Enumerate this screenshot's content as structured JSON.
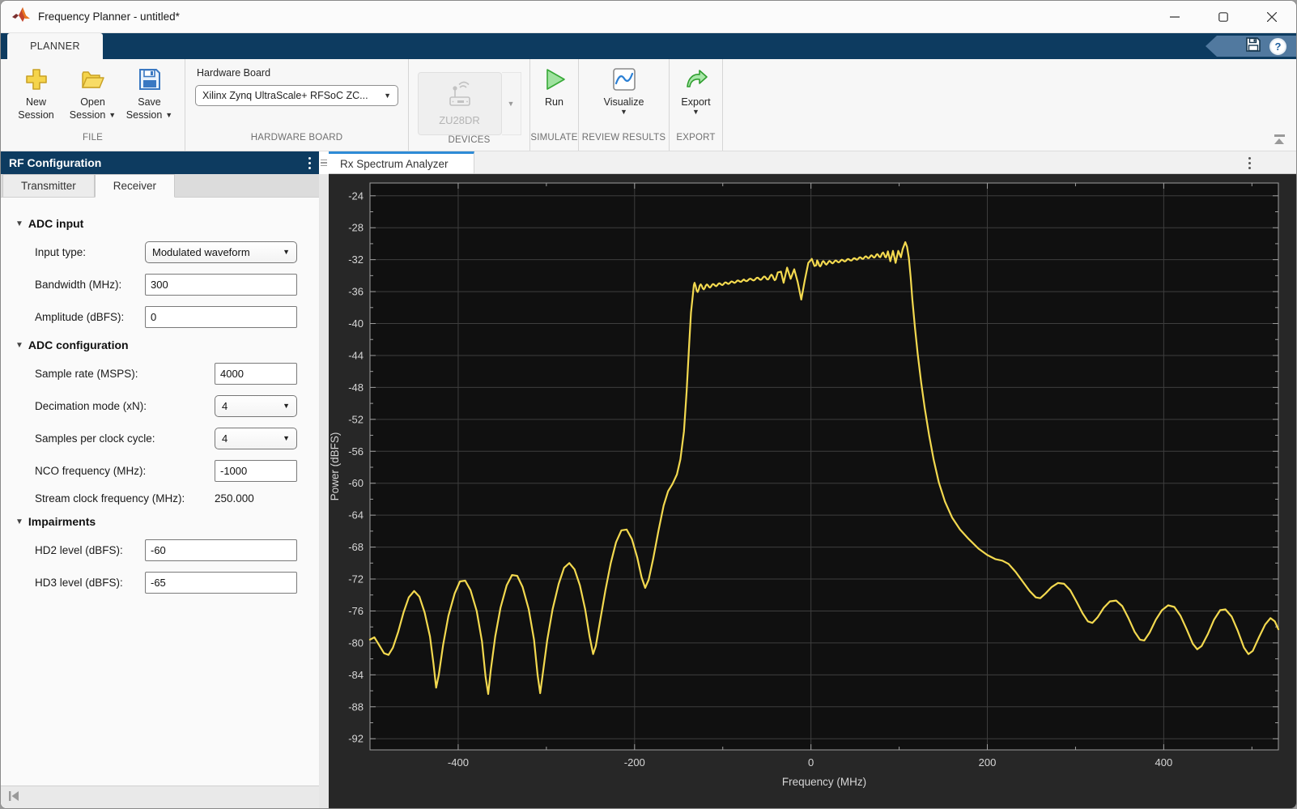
{
  "window": {
    "title": "Frequency Planner - untitled*"
  },
  "ribbon": {
    "tab_label": "PLANNER"
  },
  "toolbar": {
    "file": {
      "group_label": "FILE",
      "buttons": [
        {
          "label_top": "New",
          "label_bottom": "Session",
          "icon": "new-session-icon",
          "dropdown": false
        },
        {
          "label_top": "Open",
          "label_bottom": "Session",
          "icon": "open-folder-icon",
          "dropdown": true
        },
        {
          "label_top": "Save",
          "label_bottom": "Session",
          "icon": "save-disk-icon",
          "dropdown": true
        }
      ]
    },
    "hardware": {
      "group_label": "HARDWARE BOARD",
      "field_label": "Hardware Board",
      "dropdown_value": "Xilinx Zynq UltraScale+ RFSoC ZC..."
    },
    "devices": {
      "group_label": "DEVICES",
      "device_name": "ZU28DR"
    },
    "simulate": {
      "group_label": "SIMULATE",
      "run_label": "Run"
    },
    "review": {
      "group_label": "REVIEW RESULTS",
      "visualize_label": "Visualize"
    },
    "export": {
      "group_label": "EXPORT",
      "export_label": "Export"
    }
  },
  "left_panel": {
    "title": "RF Configuration",
    "tabs": [
      {
        "label": "Transmitter"
      },
      {
        "label": "Receiver"
      }
    ],
    "sections": [
      {
        "title": "ADC input",
        "rows": [
          {
            "label": "Input type:",
            "control": "dropdown",
            "value": "Modulated waveform",
            "narrow": false
          },
          {
            "label": "Bandwidth (MHz):",
            "control": "input",
            "value": "300",
            "narrow": false
          },
          {
            "label": "Amplitude (dBFS):",
            "control": "input",
            "value": "0",
            "narrow": false
          }
        ]
      },
      {
        "title": "ADC configuration",
        "rows": [
          {
            "label": "Sample rate (MSPS):",
            "control": "input",
            "value": "4000",
            "narrow": true
          },
          {
            "label": "Decimation mode (xN):",
            "control": "dropdown",
            "value": "4",
            "narrow": true
          },
          {
            "label": "Samples per clock cycle:",
            "control": "dropdown",
            "value": "4",
            "narrow": true
          },
          {
            "label": "NCO frequency (MHz):",
            "control": "input",
            "value": "-1000",
            "narrow": true
          },
          {
            "label": "Stream clock frequency (MHz):",
            "control": "static",
            "value": "250.000",
            "narrow": true
          }
        ]
      },
      {
        "title": "Impairments",
        "rows": [
          {
            "label": "HD2 level (dBFS):",
            "control": "input",
            "value": "-60",
            "narrow": false
          },
          {
            "label": "HD3 level (dBFS):",
            "control": "input",
            "value": "-65",
            "narrow": false
          }
        ]
      }
    ]
  },
  "plot_panel": {
    "tab_label": "Rx Spectrum Analyzer"
  },
  "colors": {
    "accent_navy": "#0d3b60",
    "tab_stripe_blue": "#2e8bd6",
    "curve_yellow": "#f3d94f"
  },
  "chart_data": {
    "type": "line",
    "title": "",
    "xlabel": "Frequency (MHz)",
    "ylabel": "Power (dBFS)",
    "xlim": [
      -500,
      530
    ],
    "ylim": [
      -93.4,
      -22.4
    ],
    "xticks": [
      -400,
      -200,
      0,
      200,
      400
    ],
    "yticks": [
      -24,
      -28,
      -32,
      -36,
      -40,
      -44,
      -48,
      -52,
      -56,
      -60,
      -64,
      -68,
      -72,
      -76,
      -80,
      -84,
      -88,
      -92
    ],
    "x_minor": [
      -500,
      -300,
      -100,
      100,
      300,
      500
    ],
    "y_minor": [
      -26,
      -30,
      -34,
      -38,
      -42,
      -46,
      -50,
      -54,
      -58,
      -62,
      -66,
      -70,
      -74,
      -78,
      -82,
      -86,
      -90
    ],
    "grid": true,
    "legend": false,
    "bg_outer": "#272727",
    "bg_axes": "#101010",
    "grid_color": "#3e3e3e",
    "frame_color": "#9e9e9e",
    "tick_label_color": "#d6d6d6",
    "line_color": "#f3d94f",
    "line_width": 2.2,
    "series": [
      {
        "name": "Rx spectrum",
        "segments": [
          {
            "type": "points",
            "pts": [
              [
                -500,
                -79.6
              ],
              [
                -495,
                -79.3
              ],
              [
                -490,
                -80.2
              ],
              [
                -484,
                -81.3
              ],
              [
                -479,
                -81.5
              ],
              [
                -474,
                -80.6
              ],
              [
                -468,
                -78.6
              ],
              [
                -462,
                -76.2
              ],
              [
                -456,
                -74.3
              ],
              [
                -450,
                -73.5
              ],
              [
                -444,
                -74.2
              ],
              [
                -438,
                -76.2
              ],
              [
                -432,
                -79.2
              ],
              [
                -428,
                -82.6
              ],
              [
                -425,
                -85.6
              ],
              [
                -422,
                -84.0
              ],
              [
                -417,
                -80.2
              ],
              [
                -411,
                -76.6
              ],
              [
                -404,
                -73.8
              ],
              [
                -398,
                -72.3
              ],
              [
                -392,
                -72.2
              ],
              [
                -386,
                -73.4
              ],
              [
                -379,
                -76.0
              ],
              [
                -373,
                -79.8
              ],
              [
                -369,
                -84.2
              ],
              [
                -366,
                -86.4
              ],
              [
                -363,
                -83.4
              ],
              [
                -358,
                -79.2
              ],
              [
                -352,
                -75.6
              ],
              [
                -345,
                -72.8
              ],
              [
                -339,
                -71.5
              ],
              [
                -333,
                -71.6
              ],
              [
                -327,
                -73.0
              ],
              [
                -320,
                -75.8
              ],
              [
                -314,
                -79.6
              ],
              [
                -310,
                -84.0
              ],
              [
                -307,
                -86.3
              ],
              [
                -304,
                -83.8
              ],
              [
                -299,
                -79.6
              ],
              [
                -293,
                -75.8
              ],
              [
                -286,
                -72.6
              ],
              [
                -280,
                -70.6
              ],
              [
                -274,
                -70.0
              ],
              [
                -268,
                -70.8
              ],
              [
                -262,
                -72.8
              ],
              [
                -256,
                -75.8
              ],
              [
                -251,
                -79.2
              ],
              [
                -247,
                -81.4
              ],
              [
                -244,
                -80.4
              ],
              [
                -239,
                -77.2
              ],
              [
                -233,
                -73.4
              ],
              [
                -227,
                -70.0
              ],
              [
                -221,
                -67.4
              ],
              [
                -215,
                -65.9
              ],
              [
                -209,
                -65.8
              ],
              [
                -203,
                -67.0
              ],
              [
                -197,
                -69.3
              ],
              [
                -192,
                -71.8
              ],
              [
                -188,
                -73.1
              ],
              [
                -184,
                -72.1
              ],
              [
                -179,
                -69.5
              ],
              [
                -173,
                -66.0
              ],
              [
                -167,
                -62.8
              ],
              [
                -162,
                -61.0
              ],
              [
                -157,
                -60.1
              ],
              [
                -152,
                -58.9
              ],
              [
                -148,
                -57.0
              ],
              [
                -144,
                -53.5
              ],
              [
                -141,
                -48.5
              ],
              [
                -138,
                -42.5
              ],
              [
                -136,
                -38.6
              ],
              [
                -134,
                -36.5
              ],
              [
                -132.8,
                -35.2
              ]
            ]
          },
          {
            "type": "ripple",
            "x0": -132,
            "x1": -76,
            "base0": -35.6,
            "base1": -34.6,
            "amp0": 0.7,
            "amp1": 0.12,
            "tau": 9,
            "period": 7.0,
            "phase_ref": "start"
          },
          {
            "type": "ripple",
            "x0": -76,
            "x1": -37,
            "base0": -34.6,
            "base1": -34.1,
            "amp0": 0.6,
            "amp1": 0.12,
            "tau": 9,
            "period": 8.0,
            "phase_ref": "end"
          },
          {
            "type": "points",
            "pts": [
              [
                -34,
                -33.5
              ],
              [
                -31,
                -34.9
              ],
              [
                -27,
                -33.0
              ],
              [
                -23,
                -34.4
              ],
              [
                -19,
                -33.2
              ],
              [
                -15,
                -34.8
              ],
              [
                -11,
                -37.0
              ],
              [
                -7,
                -34.6
              ],
              [
                -3,
                -32.4
              ],
              [
                1,
                -31.9
              ],
              [
                4,
                -32.8
              ],
              [
                6,
                -32.7
              ]
            ]
          },
          {
            "type": "ripple",
            "x0": 7,
            "x1": 45,
            "base0": -32.55,
            "base1": -32.0,
            "amp0": 0.45,
            "amp1": 0.12,
            "tau": 9,
            "period": 7.0,
            "phase_ref": "start"
          },
          {
            "type": "ripple",
            "x0": 45,
            "x1": 88,
            "base0": -32.0,
            "base1": -31.3,
            "amp0": 0.5,
            "amp1": 0.12,
            "tau": 9,
            "period": 6.5,
            "phase_ref": "end"
          },
          {
            "type": "points",
            "pts": [
              [
                90,
                -32.2
              ],
              [
                93,
                -30.9
              ],
              [
                96,
                -32.4
              ],
              [
                99,
                -30.9
              ],
              [
                102,
                -31.7
              ],
              [
                104,
                -30.7
              ],
              [
                107,
                -29.8
              ],
              [
                109,
                -30.4
              ],
              [
                111,
                -31.8
              ],
              [
                113,
                -34.2
              ],
              [
                115,
                -37.0
              ],
              [
                118,
                -40.6
              ],
              [
                121,
                -43.8
              ],
              [
                125,
                -47.4
              ],
              [
                129,
                -50.6
              ],
              [
                134,
                -54.0
              ],
              [
                139,
                -57.0
              ],
              [
                145,
                -59.9
              ],
              [
                152,
                -62.3
              ],
              [
                160,
                -64.3
              ],
              [
                169,
                -65.8
              ],
              [
                179,
                -67.0
              ],
              [
                190,
                -68.2
              ],
              [
                200,
                -69.0
              ],
              [
                209,
                -69.5
              ],
              [
                217,
                -69.7
              ],
              [
                224,
                -70.1
              ],
              [
                232,
                -71.1
              ],
              [
                240,
                -72.3
              ],
              [
                248,
                -73.5
              ],
              [
                255,
                -74.3
              ],
              [
                260,
                -74.4
              ],
              [
                266,
                -73.8
              ],
              [
                273,
                -73.0
              ],
              [
                280,
                -72.5
              ],
              [
                287,
                -72.6
              ],
              [
                294,
                -73.4
              ],
              [
                301,
                -74.8
              ],
              [
                308,
                -76.3
              ],
              [
                314,
                -77.3
              ],
              [
                319,
                -77.5
              ],
              [
                325,
                -76.8
              ],
              [
                332,
                -75.6
              ],
              [
                339,
                -74.8
              ],
              [
                346,
                -74.7
              ],
              [
                353,
                -75.4
              ],
              [
                360,
                -76.9
              ],
              [
                367,
                -78.6
              ],
              [
                373,
                -79.6
              ],
              [
                378,
                -79.7
              ],
              [
                384,
                -78.7
              ],
              [
                391,
                -77.1
              ],
              [
                398,
                -75.9
              ],
              [
                405,
                -75.3
              ],
              [
                412,
                -75.5
              ],
              [
                419,
                -76.6
              ],
              [
                426,
                -78.3
              ],
              [
                433,
                -80.1
              ],
              [
                438,
                -80.8
              ],
              [
                443,
                -80.4
              ],
              [
                450,
                -78.9
              ],
              [
                457,
                -77.1
              ],
              [
                464,
                -75.9
              ],
              [
                470,
                -75.8
              ],
              [
                477,
                -76.7
              ],
              [
                484,
                -78.5
              ],
              [
                491,
                -80.6
              ],
              [
                496,
                -81.4
              ],
              [
                501,
                -81.0
              ],
              [
                508,
                -79.3
              ],
              [
                515,
                -77.7
              ],
              [
                521,
                -76.9
              ],
              [
                526,
                -77.3
              ],
              [
                530,
                -78.3
              ]
            ]
          }
        ]
      }
    ]
  }
}
